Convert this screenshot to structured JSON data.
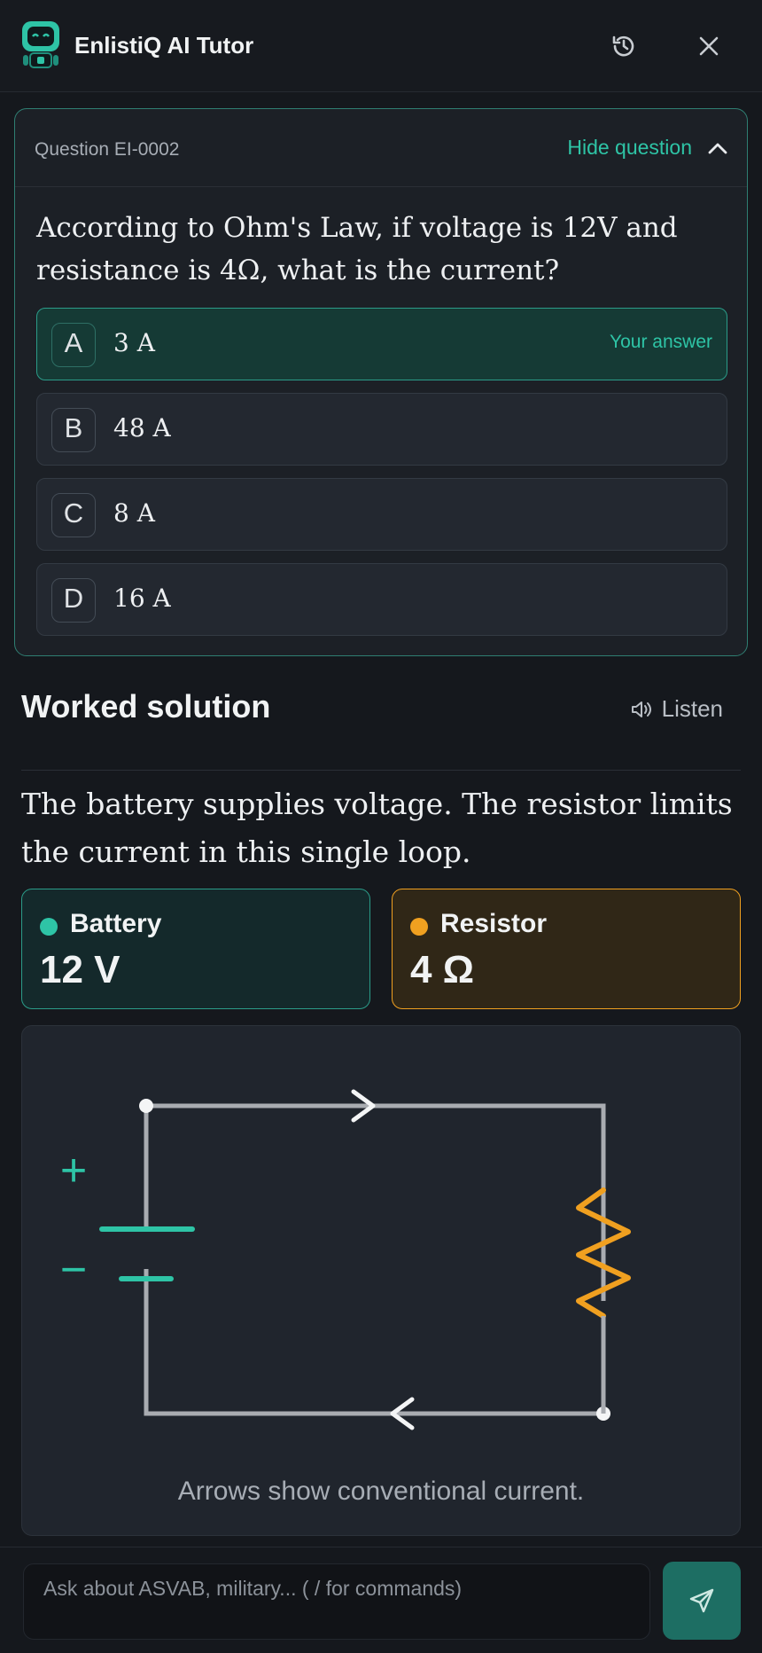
{
  "header": {
    "title": "EnlistiQ AI Tutor",
    "icons": {
      "logo": "robot-logo",
      "history": "history-icon",
      "close": "close-icon"
    }
  },
  "question": {
    "id_label": "Question EI-0002",
    "toggle_label": "Hide question",
    "text": "According to Ohm's Law, if voltage is 12V and resistance is 4Ω, what is the current?",
    "options": [
      {
        "letter": "A",
        "text": "3 A",
        "badge": "Your answer",
        "selected": true
      },
      {
        "letter": "B",
        "text": "48 A"
      },
      {
        "letter": "C",
        "text": "8 A"
      },
      {
        "letter": "D",
        "text": "16 A"
      }
    ]
  },
  "solution": {
    "title": "Worked solution",
    "listen_label": "Listen",
    "text": "The battery supplies voltage. The resistor limits the current in this single loop.",
    "components": [
      {
        "name": "Battery",
        "value": "12 V",
        "color": "#2ec4a6"
      },
      {
        "name": "Resistor",
        "value": "4 Ω",
        "color": "#f0a020"
      }
    ],
    "diagram": {
      "plus_label": "+",
      "minus_label": "−",
      "caption": "Arrows show conventional current."
    }
  },
  "composer": {
    "placeholder": "Ask about ASVAB, military... ( / for commands)",
    "send_icon": "send-icon"
  },
  "colors": {
    "accent": "#2ec4a6",
    "resistor": "#f0a020",
    "wire": "#a9acb1"
  }
}
